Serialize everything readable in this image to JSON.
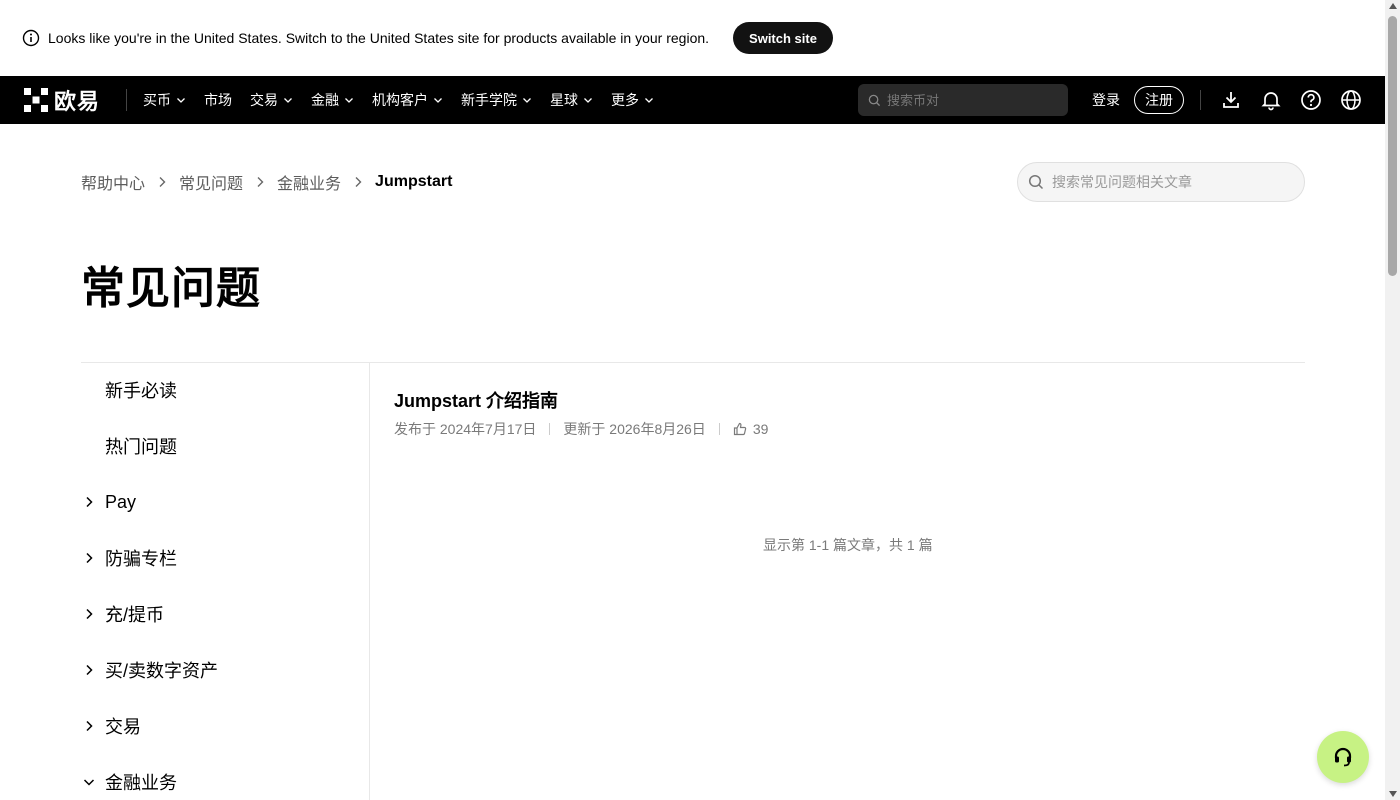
{
  "banner": {
    "text": "Looks like you're in the United States. Switch to the United States site for products available in your region.",
    "button_label": "Switch site",
    "icon": "info-icon"
  },
  "nav": {
    "logo_text": "欧易",
    "items": [
      {
        "label": "买币",
        "has_dropdown": true
      },
      {
        "label": "市场",
        "has_dropdown": false
      },
      {
        "label": "交易",
        "has_dropdown": true
      },
      {
        "label": "金融",
        "has_dropdown": true
      },
      {
        "label": "机构客户",
        "has_dropdown": true
      },
      {
        "label": "新手学院",
        "has_dropdown": true
      },
      {
        "label": "星球",
        "has_dropdown": true
      },
      {
        "label": "更多",
        "has_dropdown": true
      }
    ],
    "search_placeholder": "搜索币对",
    "login_label": "登录",
    "register_label": "注册",
    "icons": [
      "download-icon",
      "bell-icon",
      "help-icon",
      "globe-icon"
    ]
  },
  "breadcrumb": {
    "items": [
      "帮助中心",
      "常见问题",
      "金融业务"
    ],
    "current": "Jumpstart"
  },
  "help_search": {
    "placeholder": "搜索常见问题相关文章"
  },
  "page_title": "常见问题",
  "sidebar": {
    "items": [
      {
        "label": "新手必读",
        "chevron": "none"
      },
      {
        "label": "热门问题",
        "chevron": "none"
      },
      {
        "label": "Pay",
        "chevron": "right"
      },
      {
        "label": "防骗专栏",
        "chevron": "right"
      },
      {
        "label": "充/提币",
        "chevron": "right"
      },
      {
        "label": "买/卖数字资产",
        "chevron": "right"
      },
      {
        "label": "交易",
        "chevron": "right"
      },
      {
        "label": "金融业务",
        "chevron": "down"
      }
    ]
  },
  "article": {
    "title": "Jumpstart 介绍指南",
    "published": "发布于 2024年7月17日",
    "updated": "更新于 2026年8月26日",
    "likes": "39"
  },
  "pagination_text": "显示第 1-1 篇文章，共 1 篇",
  "colors": {
    "nav_bg": "#000000",
    "chat_button": "#c7f284",
    "muted_text": "#7a7a7a"
  }
}
